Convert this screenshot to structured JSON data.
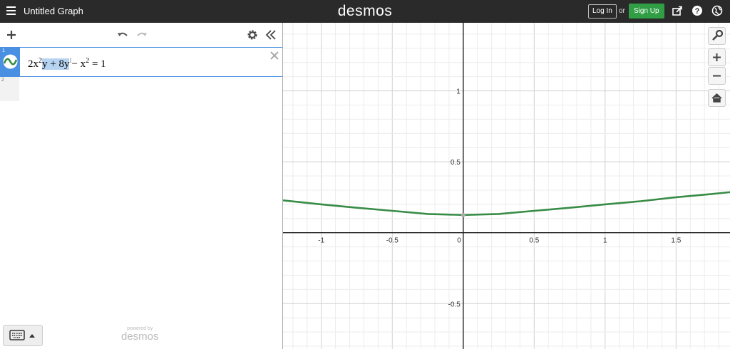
{
  "app": {
    "graph_title": "Untitled Graph",
    "brand": "desmos"
  },
  "header": {
    "login_label": "Log In",
    "or_label": "or",
    "signup_label": "Sign Up",
    "signup_color": "#2f9e44"
  },
  "icons": {
    "menu": "hamburger-icon",
    "add": "plus-icon",
    "undo": "undo-icon",
    "redo": "redo-icon",
    "settings": "gear-icon",
    "collapse": "double-chevron-left-icon",
    "share": "share-icon",
    "help": "help-icon",
    "language": "globe-icon",
    "wrench": "wrench-icon",
    "zoom_in": "zoom-in-icon",
    "zoom_out": "zoom-out-icon",
    "home": "home-icon",
    "keyboard": "keyboard-icon"
  },
  "expressions": [
    {
      "index": "1",
      "parts": {
        "a": "2x",
        "b": "2",
        "c": "y + 8y",
        "d": "− x",
        "e": "2",
        "f": " = 1"
      },
      "color": "#388c46"
    },
    {
      "index": "2"
    }
  ],
  "footer": {
    "powered_by": "powered by",
    "brand": "desmos"
  },
  "chart_data": {
    "type": "line",
    "title": "",
    "xlabel": "",
    "ylabel": "",
    "xlim": [
      -1.27,
      1.88
    ],
    "ylim": [
      -0.82,
      1.48
    ],
    "grid": true,
    "x_ticks": [
      "-1",
      "-0.5",
      "0",
      "0.5",
      "1",
      "1.5"
    ],
    "y_ticks": [
      "1",
      "0.5",
      "-0.5"
    ],
    "series": [
      {
        "color": "#388c46",
        "x": [
          -1.27,
          -1.0,
          -0.75,
          -0.5,
          -0.25,
          0,
          0.25,
          0.5,
          0.75,
          1.0,
          1.25,
          1.5,
          1.75,
          1.88
        ],
        "y": [
          0.228,
          0.2,
          0.176,
          0.154,
          0.132,
          0.125,
          0.132,
          0.154,
          0.176,
          0.2,
          0.222,
          0.25,
          0.273,
          0.286
        ]
      }
    ],
    "highlight_point": {
      "x": 0,
      "y": 0.125
    }
  }
}
